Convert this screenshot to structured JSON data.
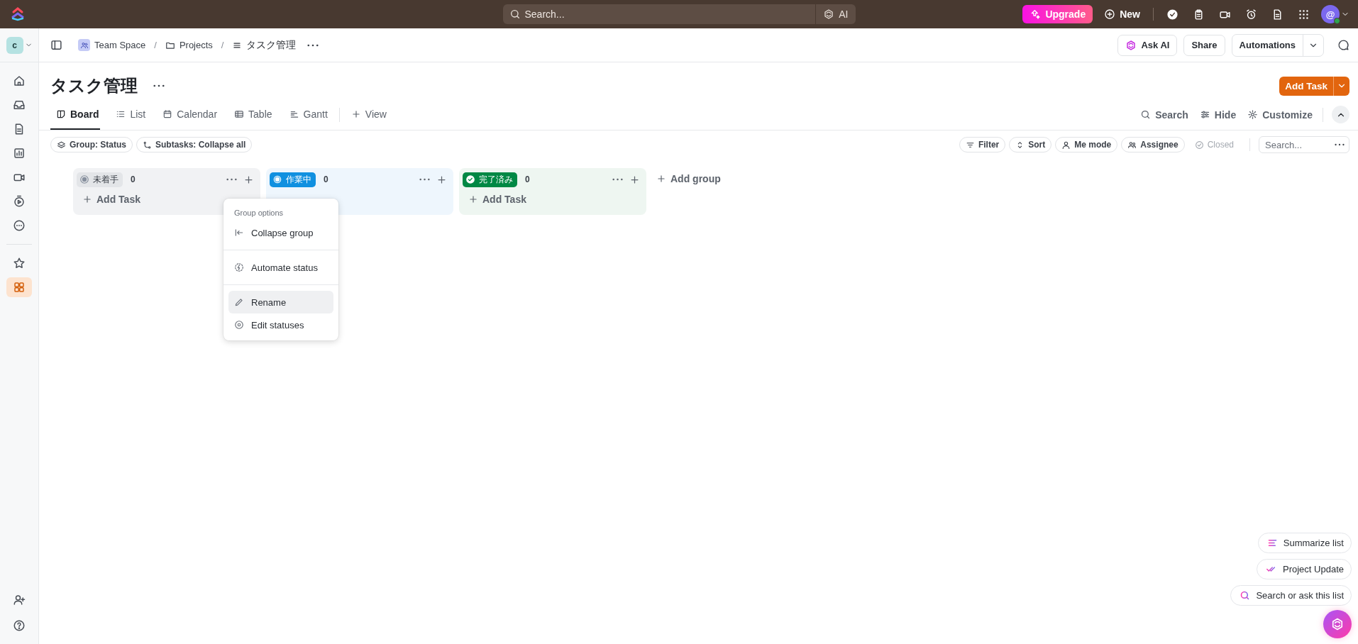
{
  "top_bar": {
    "search_placeholder": "Search...",
    "ai_button": "AI",
    "upgrade_button": "Upgrade",
    "new_button": "New"
  },
  "user": {
    "avatar": "@"
  },
  "workspace": {
    "avatar": "c"
  },
  "breadcrumb": [
    "Team Space",
    "Projects",
    "タスク管理"
  ],
  "breadcrumb_separators": [
    "/",
    "/"
  ],
  "header_actions": [
    "Ask AI",
    "Share",
    "Automations"
  ],
  "page": {
    "title": "タスク管理",
    "add_task_button": "Add Task"
  },
  "sidebar": {
    "items": [
      {
        "selected": false
      },
      {
        "selected": false
      },
      {
        "selected": false
      },
      {
        "selected": false
      },
      {
        "selected": false
      },
      {
        "selected": false
      },
      {
        "selected": false
      },
      {
        "selected": false
      },
      {
        "selected": true
      }
    ]
  },
  "view_tabs": [
    {
      "label": "Board",
      "selected": true
    },
    {
      "label": "List",
      "selected": false
    },
    {
      "label": "Calendar",
      "selected": false
    },
    {
      "label": "Table",
      "selected": false
    },
    {
      "label": "Gantt",
      "selected": false
    }
  ],
  "add_view": "View",
  "view_actions": [
    "Search",
    "Hide",
    "Customize"
  ],
  "filters_left": [
    "Group: Status",
    "Subtasks: Collapse all"
  ],
  "filters_right": [
    {
      "label": "Filter",
      "disabled": false
    },
    {
      "label": "Sort",
      "disabled": false
    },
    {
      "label": "Me mode",
      "disabled": false
    },
    {
      "label": "Assignee",
      "disabled": false
    },
    {
      "label": "Closed",
      "disabled": true
    }
  ],
  "board_search": {
    "placeholder": "Search..."
  },
  "groups": [
    {
      "kind": "todo",
      "status": "未着手",
      "count": "0",
      "color": "#87909e",
      "add_task": "Add Task"
    },
    {
      "kind": "progress",
      "status": "作業中",
      "count": "0",
      "color": "#1090e0"
    },
    {
      "kind": "done",
      "status": "完了済み",
      "count": "0",
      "color": "#008844",
      "add_task": "Add Task"
    }
  ],
  "add_group": "Add group",
  "group_menu": {
    "title": "Group options",
    "sections": [
      [
        {
          "label": "Collapse group",
          "highlighted": false
        }
      ],
      [
        {
          "label": "Automate status",
          "highlighted": false
        }
      ],
      [
        {
          "label": "Rename",
          "highlighted": true
        },
        {
          "label": "Edit statuses",
          "highlighted": false
        }
      ]
    ]
  },
  "ai_actions": [
    "Summarize list",
    "Project Update",
    "Search or ask this list"
  ]
}
